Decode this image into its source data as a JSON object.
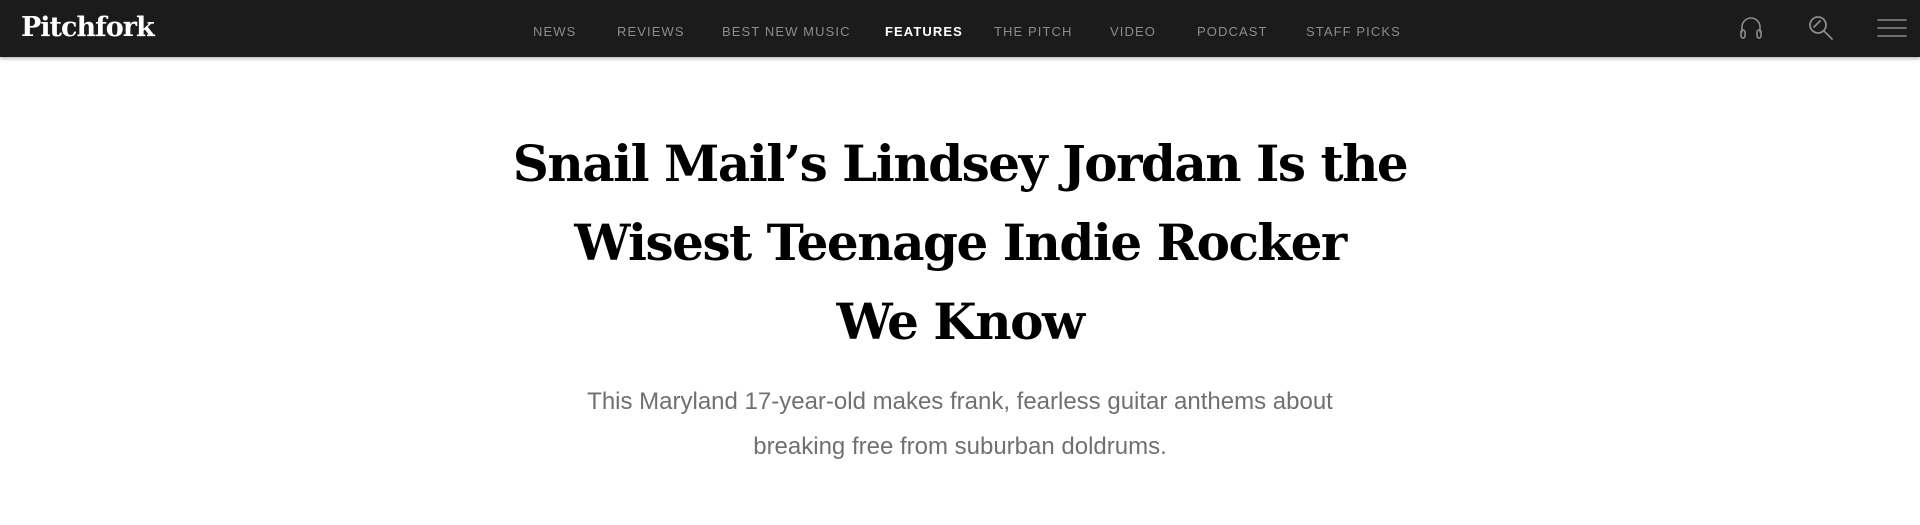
{
  "site": {
    "logo": "Pitchfork"
  },
  "nav": {
    "items": [
      {
        "label": "NEWS"
      },
      {
        "label": "REVIEWS"
      },
      {
        "label": "BEST NEW MUSIC"
      },
      {
        "label": "FEATURES",
        "active": true
      },
      {
        "label": "THE PITCH"
      },
      {
        "label": "VIDEO"
      },
      {
        "label": "PODCAST"
      },
      {
        "label": "STAFF PICKS"
      }
    ],
    "icons": [
      "headphones-icon",
      "search-icon",
      "menu-icon"
    ]
  },
  "article": {
    "headline_lines": [
      "Snail Mail’s Lindsey Jordan Is the",
      "Wisest Teenage Indie Rocker",
      "We Know"
    ],
    "dek_lines": [
      "This Maryland 17-year-old makes frank, fearless guitar anthems about",
      "breaking free from suburban doldrums."
    ]
  },
  "colors": {
    "navbar_bg": "#1b1b1b",
    "nav_inactive": "#8c8c8c",
    "nav_active": "#ffffff",
    "headline": "#000000",
    "dek": "#707070"
  }
}
